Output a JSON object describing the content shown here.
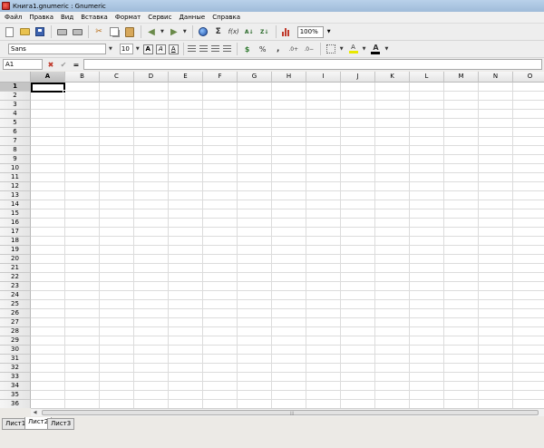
{
  "window": {
    "title": "Книга1.gnumeric : Gnumeric"
  },
  "menu": [
    "Файл",
    "Правка",
    "Вид",
    "Вставка",
    "Формат",
    "Сервис",
    "Данные",
    "Справка"
  ],
  "toolbar": {
    "zoom": "100%"
  },
  "format_toolbar": {
    "font_name": "Sans",
    "font_size": "10",
    "bold_label": "A",
    "italic_label": "A",
    "underline_label": "A",
    "fill_label": "A",
    "font_color_label": "A"
  },
  "formula_bar": {
    "cell_ref": "A1",
    "eq_label": "=",
    "value": ""
  },
  "grid": {
    "columns": [
      "A",
      "B",
      "C",
      "D",
      "E",
      "F",
      "G",
      "H",
      "I",
      "J",
      "K",
      "L",
      "M",
      "N",
      "O"
    ],
    "rows": [
      "1",
      "2",
      "3",
      "4",
      "5",
      "6",
      "7",
      "8",
      "9",
      "10",
      "11",
      "12",
      "13",
      "14",
      "15",
      "16",
      "17",
      "18",
      "19",
      "20",
      "21",
      "22",
      "23",
      "24",
      "25",
      "26",
      "27",
      "28",
      "29",
      "30",
      "31",
      "32",
      "33",
      "34",
      "35",
      "36"
    ],
    "active_column": "A",
    "active_row": "1"
  },
  "sheets": [
    {
      "name": "Лист1",
      "active": false
    },
    {
      "name": "Лист2",
      "active": true
    },
    {
      "name": "Лист3",
      "active": false
    }
  ]
}
